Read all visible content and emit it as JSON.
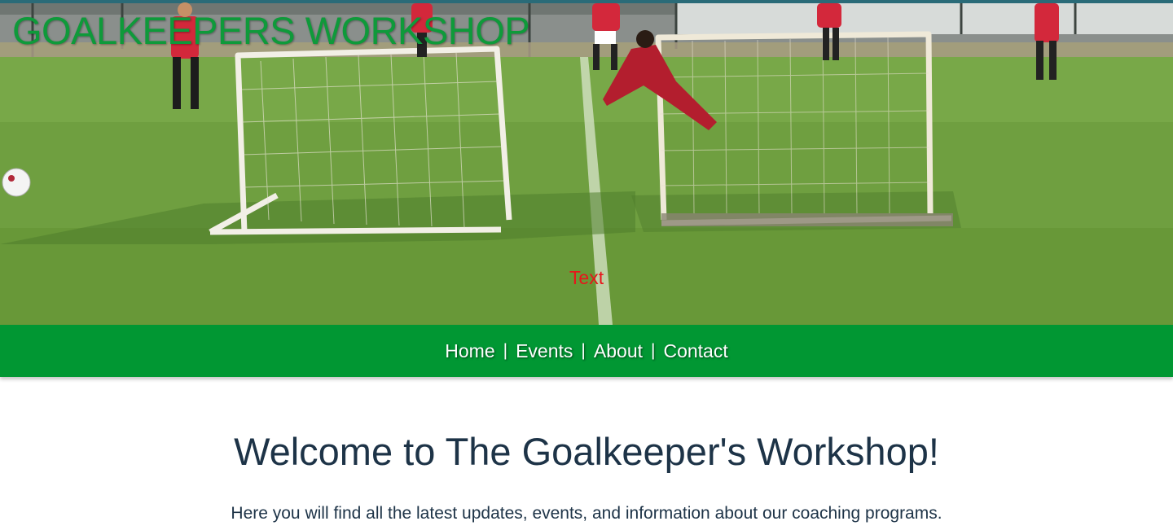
{
  "hero": {
    "site_title": "GOALKEEPERS WORKSHOP",
    "caption": "Text",
    "background_image": "soccer-training-photo"
  },
  "nav": {
    "items": [
      {
        "label": "Home"
      },
      {
        "label": "Events"
      },
      {
        "label": "About"
      },
      {
        "label": "Contact"
      }
    ],
    "separator": "|"
  },
  "main": {
    "heading": "Welcome to The Goalkeeper's Workshop!",
    "intro": "Here you will find all the latest updates, events, and information about our coaching programs."
  },
  "colors": {
    "nav_background": "#019733",
    "site_title": "#0e9a3a",
    "caption": "#e8151b",
    "heading_text": "#1d3347"
  }
}
